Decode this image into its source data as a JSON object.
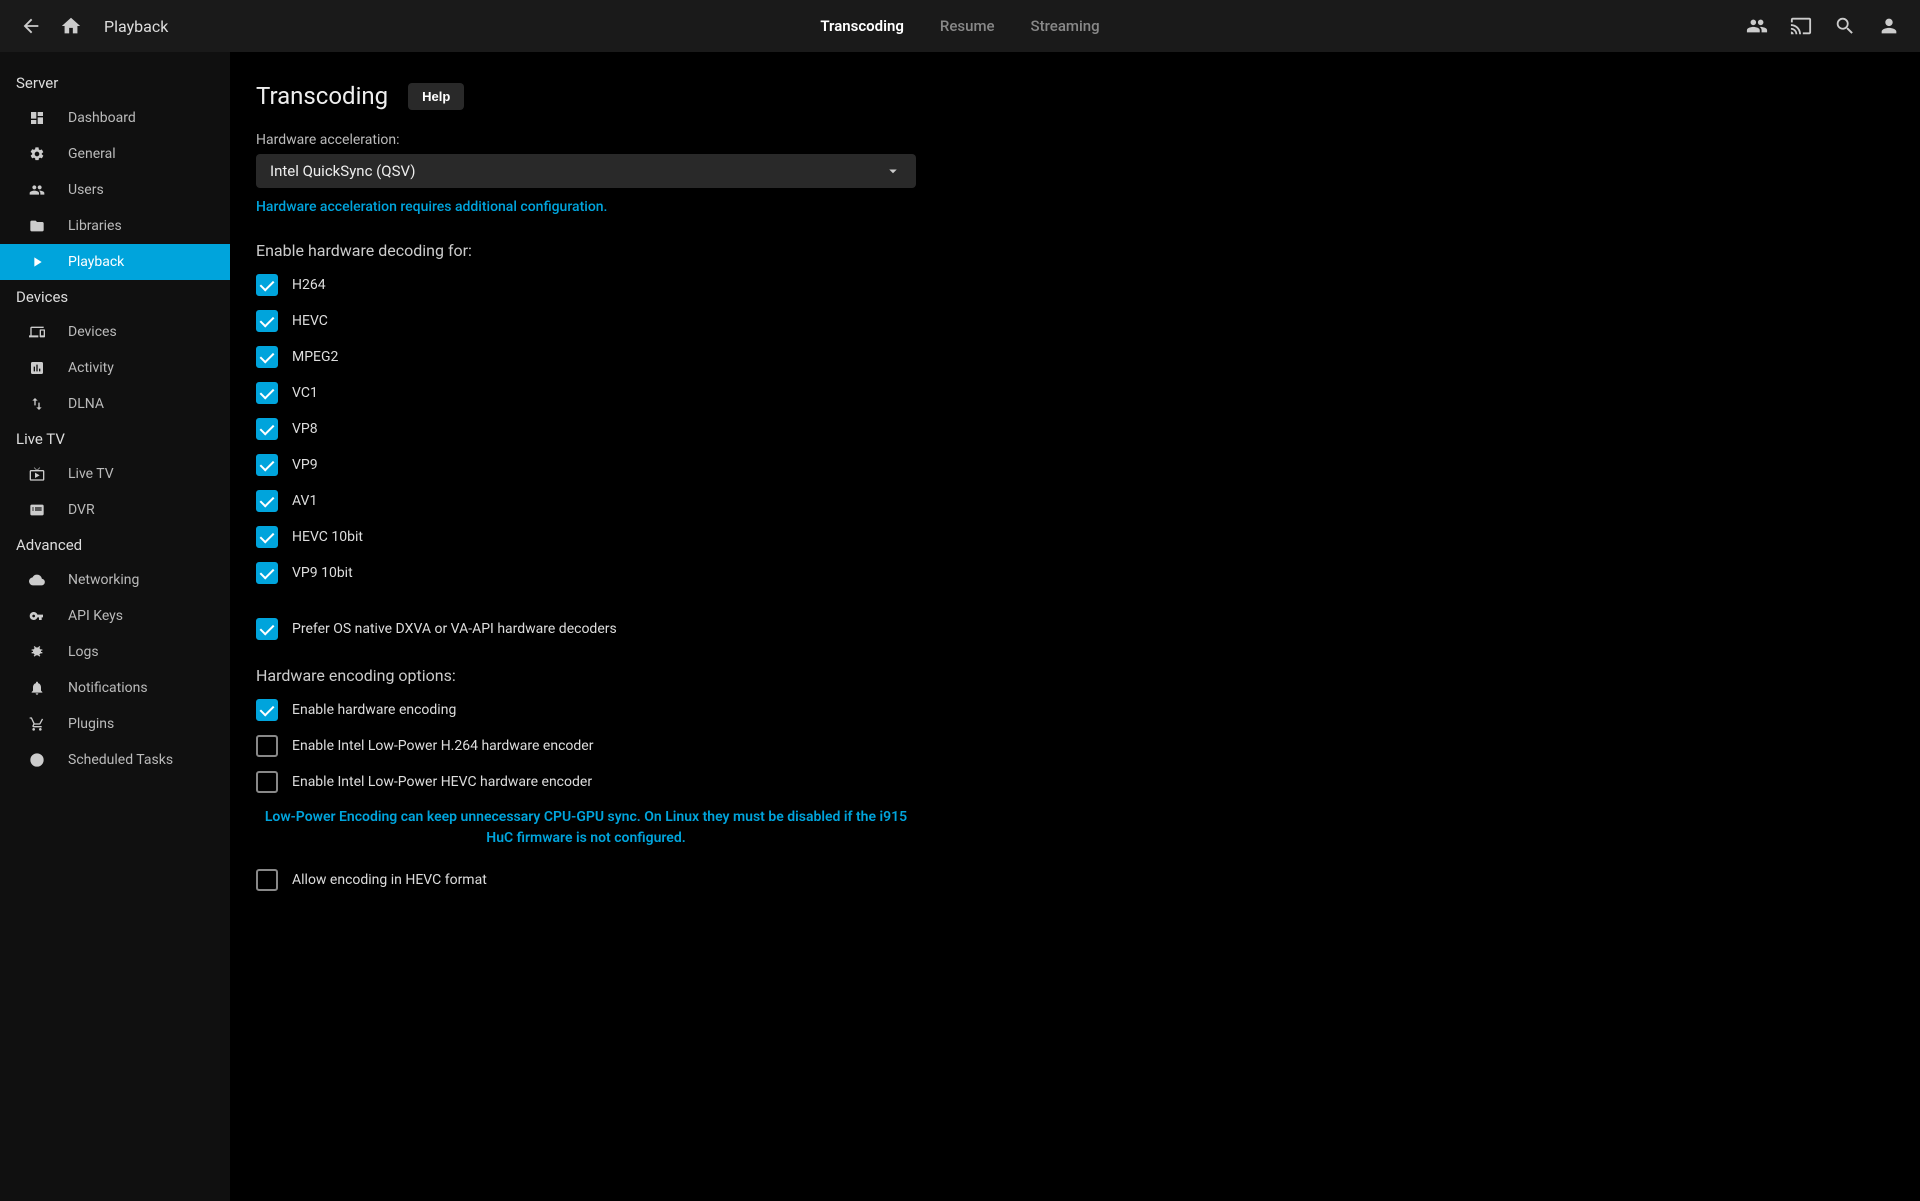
{
  "header": {
    "title": "Playback",
    "tabs": [
      "Transcoding",
      "Resume",
      "Streaming"
    ],
    "active_tab": 0
  },
  "sidebar": {
    "sections": [
      {
        "title": "Server",
        "items": [
          {
            "label": "Dashboard",
            "icon": "dashboard"
          },
          {
            "label": "General",
            "icon": "settings"
          },
          {
            "label": "Users",
            "icon": "users"
          },
          {
            "label": "Libraries",
            "icon": "folder"
          },
          {
            "label": "Playback",
            "icon": "play",
            "active": true
          }
        ]
      },
      {
        "title": "Devices",
        "items": [
          {
            "label": "Devices",
            "icon": "devices"
          },
          {
            "label": "Activity",
            "icon": "activity"
          },
          {
            "label": "DLNA",
            "icon": "dlna"
          }
        ]
      },
      {
        "title": "Live TV",
        "items": [
          {
            "label": "Live TV",
            "icon": "livetv"
          },
          {
            "label": "DVR",
            "icon": "dvr"
          }
        ]
      },
      {
        "title": "Advanced",
        "items": [
          {
            "label": "Networking",
            "icon": "cloud"
          },
          {
            "label": "API Keys",
            "icon": "key"
          },
          {
            "label": "Logs",
            "icon": "bug"
          },
          {
            "label": "Notifications",
            "icon": "bell"
          },
          {
            "label": "Plugins",
            "icon": "plugins"
          },
          {
            "label": "Scheduled Tasks",
            "icon": "clock"
          }
        ]
      }
    ]
  },
  "main": {
    "title": "Transcoding",
    "help_label": "Help",
    "hw_accel": {
      "label": "Hardware acceleration:",
      "value": "Intel QuickSync (QSV)",
      "hint": "Hardware acceleration requires additional configuration."
    },
    "decode_section_label": "Enable hardware decoding for:",
    "decoding_checks": [
      {
        "label": "H264",
        "checked": true
      },
      {
        "label": "HEVC",
        "checked": true
      },
      {
        "label": "MPEG2",
        "checked": true
      },
      {
        "label": "VC1",
        "checked": true
      },
      {
        "label": "VP8",
        "checked": true
      },
      {
        "label": "VP9",
        "checked": true
      },
      {
        "label": "AV1",
        "checked": true
      },
      {
        "label": "HEVC 10bit",
        "checked": true
      },
      {
        "label": "VP9 10bit",
        "checked": true
      }
    ],
    "prefer_native": {
      "label": "Prefer OS native DXVA or VA-API hardware decoders",
      "checked": true
    },
    "encode_section_label": "Hardware encoding options:",
    "encoding_checks": [
      {
        "label": "Enable hardware encoding",
        "checked": true
      },
      {
        "label": "Enable Intel Low-Power H.264 hardware encoder",
        "checked": false
      },
      {
        "label": "Enable Intel Low-Power HEVC hardware encoder",
        "checked": false
      }
    ],
    "lowpower_note": "Low-Power Encoding can keep unnecessary CPU-GPU sync. On Linux they must be disabled if the i915 HuC firmware is not configured.",
    "allow_hevc": {
      "label": "Allow encoding in HEVC format",
      "checked": false
    }
  }
}
